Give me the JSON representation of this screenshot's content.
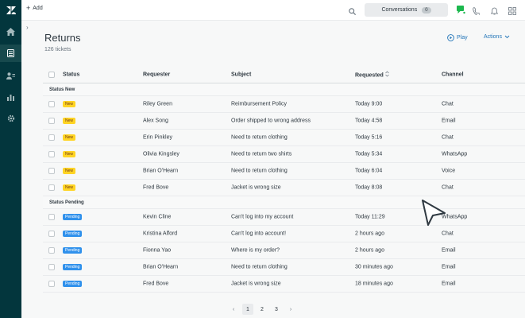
{
  "topbar": {
    "add_label": "Add",
    "conversations_label": "Conversations",
    "conversations_count": "0"
  },
  "rail": {
    "items": [
      {
        "icon": "zendesk-logo-icon"
      },
      {
        "icon": "home-icon"
      },
      {
        "icon": "views-icon",
        "active": true
      },
      {
        "icon": "customers-icon"
      },
      {
        "icon": "reporting-icon"
      },
      {
        "icon": "admin-gear-icon"
      }
    ]
  },
  "view": {
    "title": "Returns",
    "count": "126 tickets",
    "play_label": "Play",
    "actions_label": "Actions"
  },
  "table": {
    "columns": {
      "status": "Status",
      "requester": "Requester",
      "subject": "Subject",
      "requested": "Requested",
      "channel": "Channel"
    },
    "groups": [
      {
        "label": "Status New",
        "rows": [
          {
            "status": "New",
            "requester": "Riley Green",
            "subject": "Reimbursement Policy",
            "requested": "Today 9:00",
            "channel": "Chat"
          },
          {
            "status": "New",
            "requester": "Alex Song",
            "subject": "Order shipped to wrong address",
            "requested": "Today 4:58",
            "channel": "Email"
          },
          {
            "status": "New",
            "requester": "Erin Pinkley",
            "subject": "Need to return clothing",
            "requested": "Today 5:16",
            "channel": "Chat"
          },
          {
            "status": "New",
            "requester": "Olivia Kingsley",
            "subject": "Need to return two shirts",
            "requested": "Today 5:34",
            "channel": "WhatsApp"
          },
          {
            "status": "New",
            "requester": "Brian O'Hearn",
            "subject": "Need to return clothing",
            "requested": "Today 6:04",
            "channel": "Voice"
          },
          {
            "status": "New",
            "requester": "Fred Bove",
            "subject": "Jacket is wrong size",
            "requested": "Today 8:08",
            "channel": "Chat"
          }
        ]
      },
      {
        "label": "Status Pending",
        "rows": [
          {
            "status": "Pending",
            "requester": "Kevin Cline",
            "subject": "Can't log into my account",
            "requested": "Today 11:29",
            "channel": "WhatsApp"
          },
          {
            "status": "Pending",
            "requester": "Kristina Alford",
            "subject": "Can't log into account!",
            "requested": "2 hours ago",
            "channel": "Chat"
          },
          {
            "status": "Pending",
            "requester": "Fionna Yao",
            "subject": "Where is my order?",
            "requested": "2 hours ago",
            "channel": "Email"
          },
          {
            "status": "Pending",
            "requester": "Brian O'Hearn",
            "subject": "Need to return clothing",
            "requested": "30 minutes ago",
            "channel": "Email"
          },
          {
            "status": "Pending",
            "requester": "Fred Bove",
            "subject": "Jacket is wrong size",
            "requested": "18 minutes ago",
            "channel": "Email"
          }
        ]
      }
    ]
  },
  "pagination": {
    "prev": "‹",
    "pages": [
      "1",
      "2",
      "3"
    ],
    "current": "1",
    "next": "›"
  },
  "colors": {
    "rail": "#03363d",
    "new_badge": "#ffd424",
    "pending_badge": "#3091ec",
    "link": "#1f73b7",
    "chat_status": "#1cb84e"
  }
}
